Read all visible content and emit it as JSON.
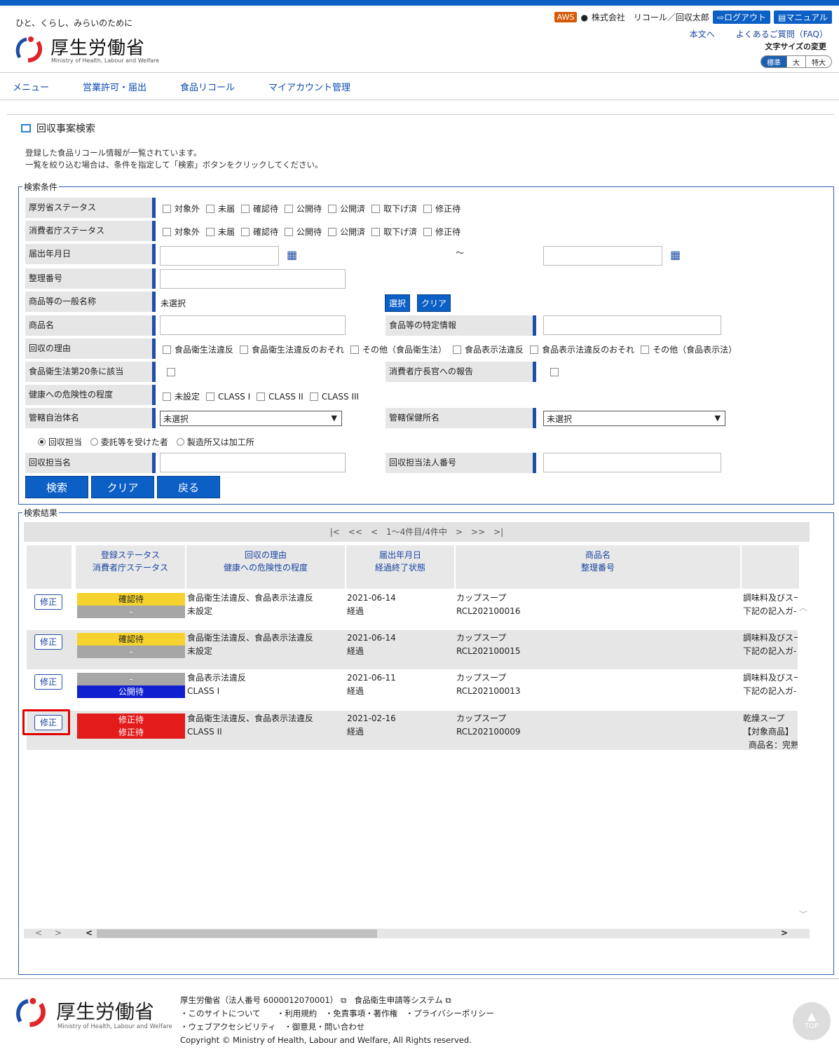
{
  "header": {
    "tagline": "ひと、くらし、みらいのために",
    "logo_ja": "厚生労働省",
    "logo_en": "Ministry of Health, Labour and Welfare",
    "aws": "AWS",
    "user": "株式会社　リコール／回収太郎",
    "logout": "ログアウト",
    "manual": "マニュアル",
    "link_main": "本文へ",
    "link_faq": "よくあるご質問（FAQ）",
    "fontsize_label": "文字サイズの変更",
    "fontsize": [
      "標準",
      "大",
      "特大"
    ]
  },
  "nav": [
    "メニュー",
    "営業許可・届出",
    "食品リコール",
    "マイアカウント管理"
  ],
  "page": {
    "title": "回収事案検索",
    "desc1": "登録した食品リコール情報が一覧されています。",
    "desc2": "一覧を絞り込む場合は、条件を指定して「検索」ボタンをクリックしてください。"
  },
  "search": {
    "legend": "検索条件",
    "labels": {
      "mhlw_status": "厚労省ステータス",
      "caa_status": "消費者庁ステータス",
      "date": "届出年月日",
      "number": "整理番号",
      "general_name": "商品等の一般名称",
      "product_name": "商品名",
      "specific": "食品等の特定情報",
      "reason": "回収の理由",
      "art20": "食品衛生法第20条に該当",
      "report": "消費者庁長官への報告",
      "risk": "健康への危険性の程度",
      "municipality": "管轄自治体名",
      "health_center": "管轄保健所名",
      "recall_person": "回収担当名",
      "corp_number": "回収担当法人番号"
    },
    "status_opts": [
      "対象外",
      "未届",
      "確認待",
      "公開待",
      "公開済",
      "取下げ済",
      "修正待"
    ],
    "tilde": "～",
    "unselected": "未選択",
    "select_btn": "選択",
    "clear_small": "クリア",
    "reason_opts": [
      "食品衛生法違反",
      "食品衛生法違反のおそれ",
      "その他（食品衛生法）",
      "食品表示法違反",
      "食品表示法違反のおそれ",
      "その他（食品表示法）"
    ],
    "risk_opts": [
      "未設定",
      "CLASS I",
      "CLASS II",
      "CLASS III"
    ],
    "radio_opts": [
      "回収担当",
      "委託等を受けた者",
      "製造所又は加工所"
    ],
    "buttons": [
      "検索",
      "クリア",
      "戻る"
    ]
  },
  "results": {
    "legend": "検索結果",
    "pager": "|<　<<　<　1～4件目/4件中　>　>>　>|",
    "headers": [
      [
        "登録ステータス",
        "消費者庁ステータス"
      ],
      [
        "回収の理由",
        "健康への危険性の程度"
      ],
      [
        "届出年月日",
        "経過終了状態"
      ],
      [
        "商品名",
        "整理番号"
      ]
    ],
    "edit": "修正",
    "rows": [
      {
        "s1": "確認待",
        "s1c": "#f6d22e",
        "s2": "-",
        "s2c": "#a6a6a6",
        "reason": "食品衛生法違反、食品表示法違反",
        "risk": "未設定",
        "date": "2021-06-14",
        "elapsed": "経過",
        "name": "カップスープ",
        "num": "RCL202100016",
        "extra1": "調味料及びスー",
        "extra2": "下記の記入ガ-"
      },
      {
        "s1": "確認待",
        "s1c": "#f6d22e",
        "s2": "-",
        "s2c": "#a6a6a6",
        "reason": "食品衛生法違反、食品表示法違反",
        "risk": "未設定",
        "date": "2021-06-14",
        "elapsed": "経過",
        "name": "カップスープ",
        "num": "RCL202100015",
        "extra1": "調味料及びスー",
        "extra2": "下記の記入ガ-"
      },
      {
        "s1": "-",
        "s1c": "#a6a6a6",
        "s2": "公開待",
        "s2c": "#1020d0",
        "reason": "食品表示法違反",
        "risk": "CLASS I",
        "date": "2021-06-11",
        "elapsed": "経過",
        "name": "カップスープ",
        "num": "RCL202100013",
        "extra1": "調味料及びスー",
        "extra2": "下記の記入ガ-"
      },
      {
        "s1": "修正待",
        "s1c": "#e31b1b",
        "s2": "修正待",
        "s2c": "#e31b1b",
        "reason": "食品衛生法違反、食品表示法違反",
        "risk": "CLASS II",
        "date": "2021-02-16",
        "elapsed": "経過",
        "name": "カップスープ",
        "num": "RCL202100009",
        "extra1": "乾燥スープ",
        "extra2": "【対象商品】",
        "extra3": "商品名：完熟"
      }
    ]
  },
  "footer": {
    "line1": "厚生労働省（法人番号 6000012070001）",
    "line1b": "食品衛生申請等システム",
    "links1": [
      "・このサイトについて",
      "・利用規約",
      "・免責事項・著作権",
      "・プライバシーポリシー"
    ],
    "links2": [
      "・ウェブアクセシビリティ",
      "・御意見・問い合わせ"
    ],
    "copyright": "Copyright © Ministry of Health, Labour and Welfare, All Rights reserved.",
    "top": "TOP"
  }
}
